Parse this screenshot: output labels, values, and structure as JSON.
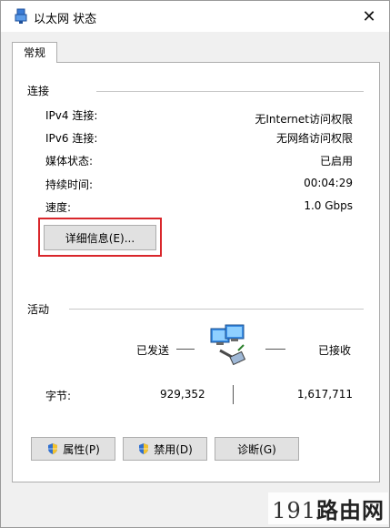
{
  "window": {
    "title": "以太网 状态",
    "close_label": "✕"
  },
  "tabs": [
    {
      "label": "常规"
    }
  ],
  "connection": {
    "section_title": "连接",
    "rows": [
      {
        "label": "IPv4 连接:",
        "value": "无Internet访问权限"
      },
      {
        "label": "IPv6 连接:",
        "value": "无网络访问权限"
      },
      {
        "label": "媒体状态:",
        "value": "已启用"
      },
      {
        "label": "持续时间:",
        "value": "00:04:29"
      },
      {
        "label": "速度:",
        "value": "1.0 Gbps"
      }
    ],
    "details_button": "详细信息(E)..."
  },
  "activity": {
    "section_title": "活动",
    "sent_label": "已发送",
    "received_label": "已接收",
    "bytes_label": "字节:",
    "bytes_sent": "929,352",
    "bytes_received": "1,617,711"
  },
  "buttons": {
    "properties": "属性(P)",
    "disable": "禁用(D)",
    "diagnose": "诊断(G)"
  },
  "watermark": {
    "number": "191",
    "text": "路由网"
  },
  "colors": {
    "highlight": "#d9262b",
    "panel_border": "#adadad"
  }
}
